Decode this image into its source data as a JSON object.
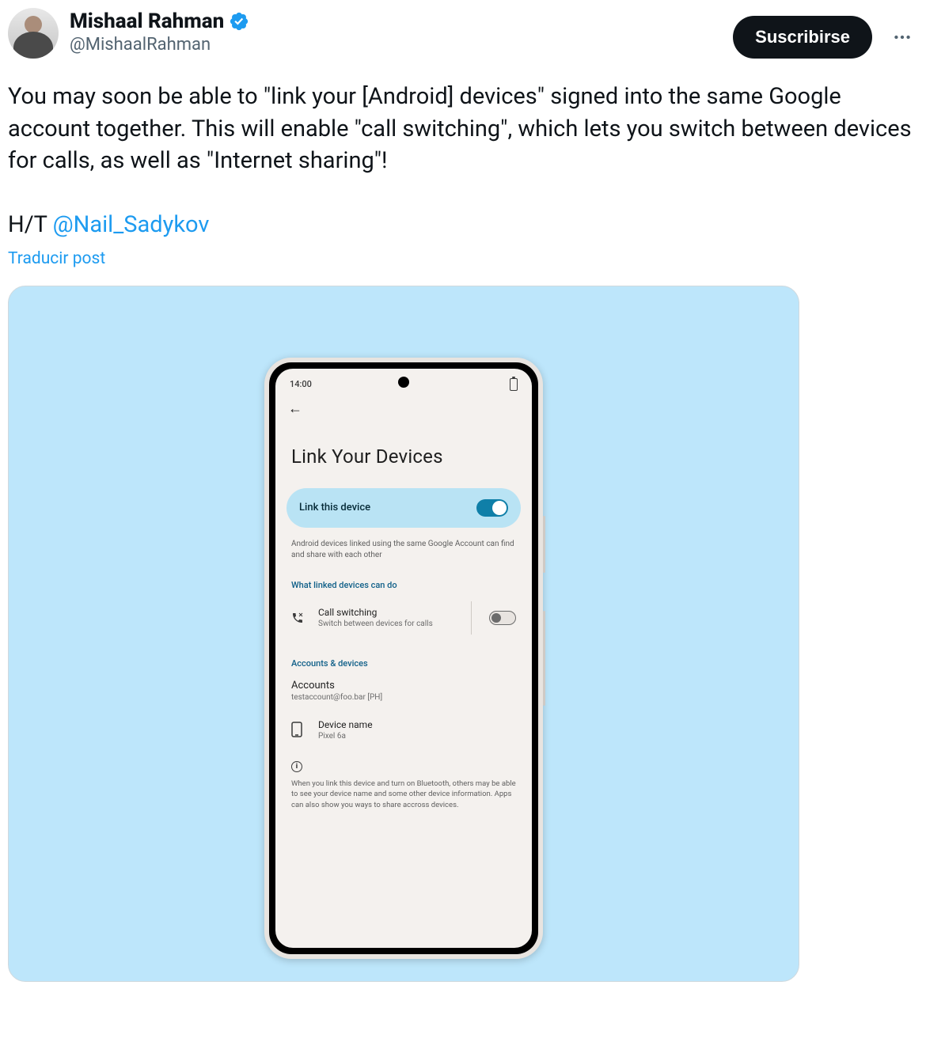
{
  "author": {
    "display_name": "Mishaal Rahman",
    "handle": "@MishaalRahman"
  },
  "actions": {
    "subscribe_label": "Suscribirse"
  },
  "tweet": {
    "text_1": "You may soon be able to \"link your [Android] devices\" signed into the same Google account together. This will enable \"call switching\", which lets you switch between devices for calls, as well as \"Internet sharing\"!",
    "ht_prefix": "H/T ",
    "mention": "@Nail_Sadykov",
    "translate_label": "Traducir post"
  },
  "phone": {
    "status_time": "14:00",
    "back_glyph": "←",
    "page_title": "Link Your Devices",
    "toggle_card_label": "Link this device",
    "toggle_desc": "Android devices linked using the same Google Account can find and share with each other",
    "section_capabilities": "What linked devices can do",
    "cap_row": {
      "title": "Call switching",
      "sub": "Switch between devices for calls"
    },
    "section_accounts": "Accounts & devices",
    "accounts_row": {
      "title": "Accounts",
      "sub": "testaccount@foo.bar [PH]"
    },
    "device_row": {
      "title": "Device name",
      "sub": "Pixel 6a"
    },
    "info_glyph": "i",
    "info_text": "When you link this device and turn on Bluetooth, others may be able to see your device name and some other device information. Apps can also show you ways to share accross devices."
  }
}
